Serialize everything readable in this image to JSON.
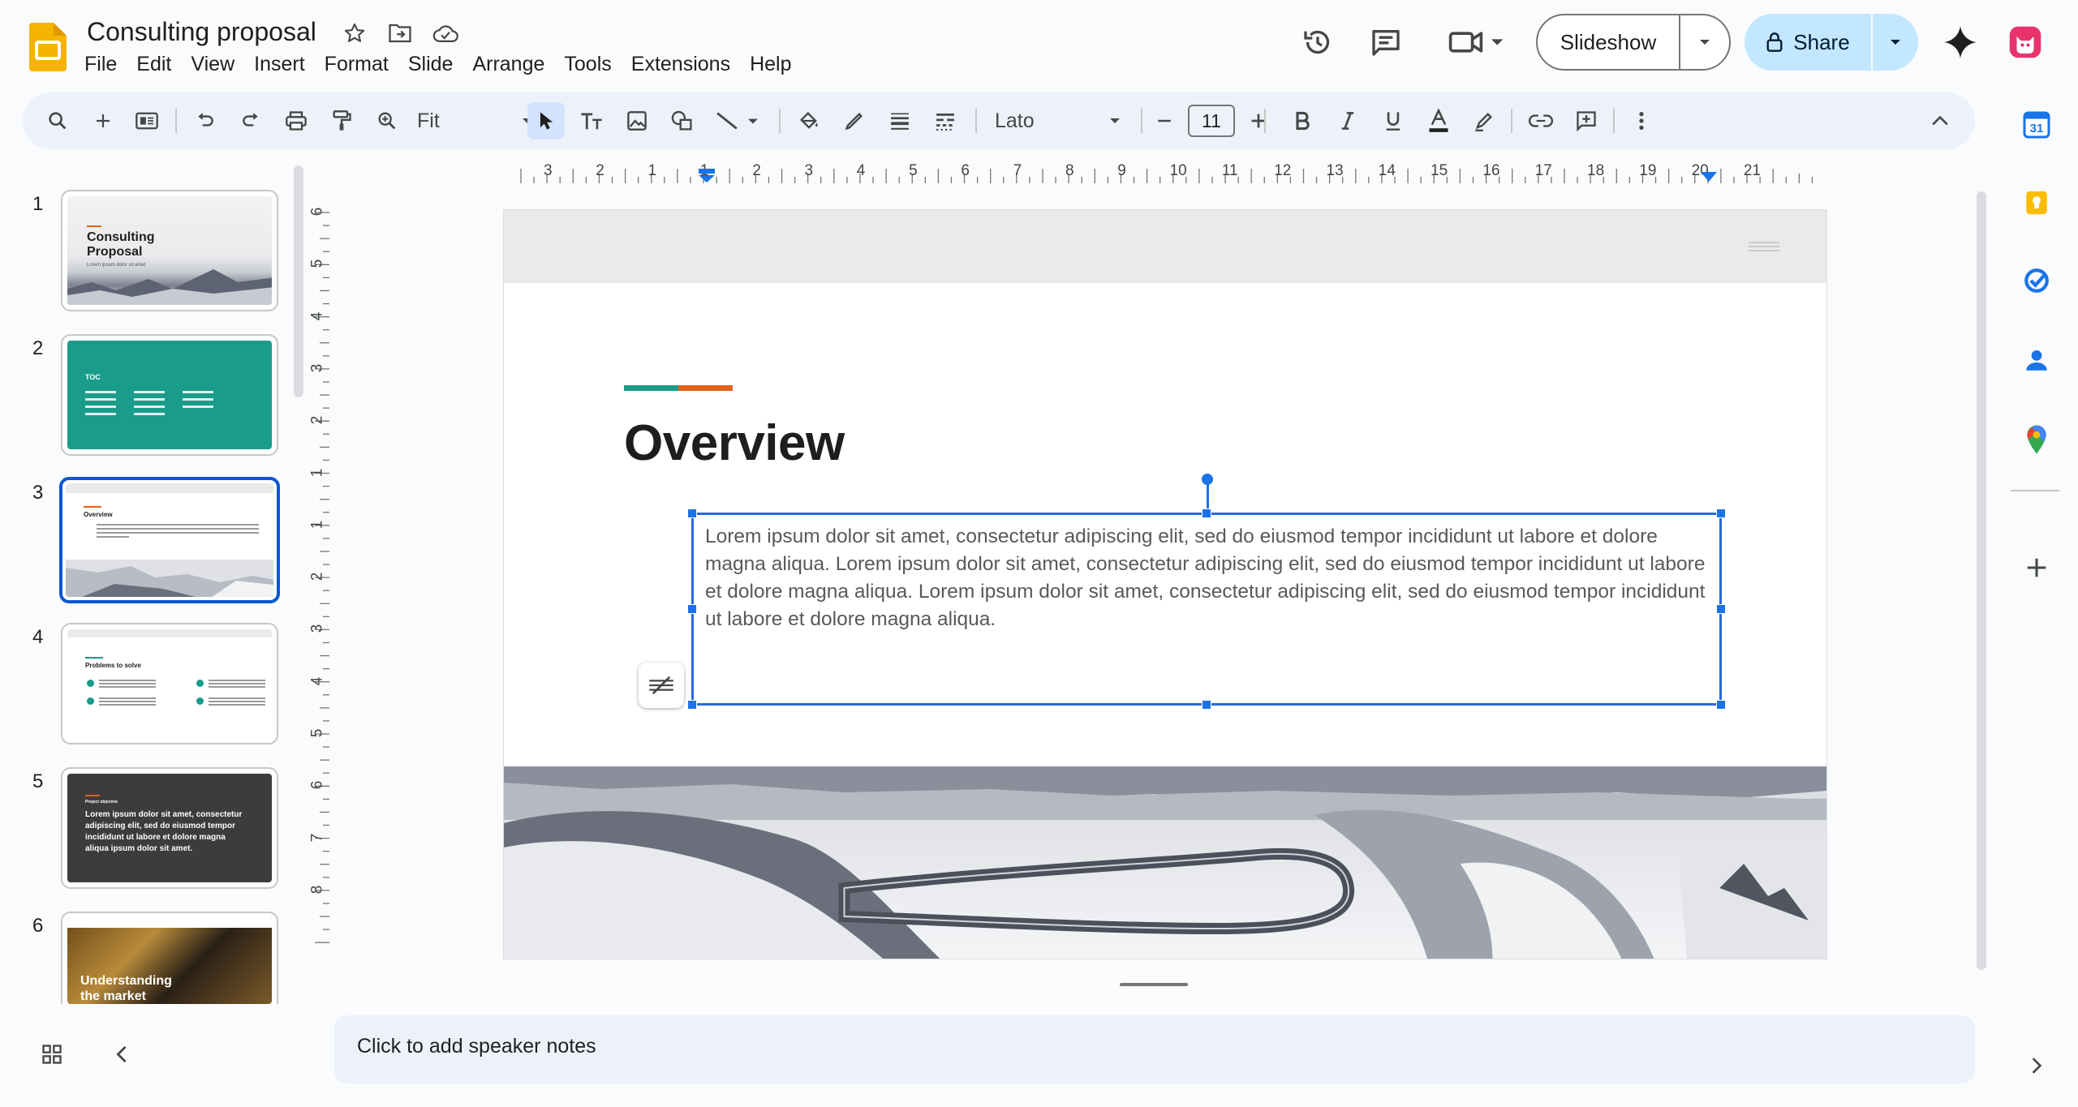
{
  "header": {
    "doc_title": "Consulting proposal",
    "menu": [
      "File",
      "Edit",
      "View",
      "Insert",
      "Format",
      "Slide",
      "Arrange",
      "Tools",
      "Extensions",
      "Help"
    ],
    "slideshow_label": "Slideshow",
    "share_label": "Share",
    "icons": [
      "star-icon",
      "move-to-folder-icon",
      "cloud-saved-icon",
      "version-history-icon",
      "comments-icon",
      "meet-icon",
      "gemini-icon",
      "profile-avatar"
    ]
  },
  "toolbar": {
    "zoom": "Fit",
    "font": "Lato",
    "font_size": "11"
  },
  "filmstrip": {
    "slides": [
      {
        "num": "1",
        "title": "Consulting Proposal",
        "sub": "Lorem ipsum dolor sit amet"
      },
      {
        "num": "2",
        "title": "TOC"
      },
      {
        "num": "3",
        "title": "Overview"
      },
      {
        "num": "4",
        "title": "Problems to solve"
      },
      {
        "num": "5",
        "title": "Project objective",
        "body": "Lorem ipsum dolor sit amet, consectetur adipiscing elit, sed do eiusmod tempor incididunt ut labore et dolore magna aliqua ipsum dolor sit amet."
      },
      {
        "num": "6",
        "title": "Understanding the market"
      }
    ]
  },
  "ruler": {
    "h_labels": [
      "3",
      "2",
      "1",
      "1",
      "2",
      "3",
      "4",
      "5",
      "6",
      "7",
      "8",
      "9",
      "10",
      "11",
      "12",
      "13",
      "14",
      "15",
      "16",
      "17",
      "18",
      "19",
      "20",
      "21"
    ],
    "v_labels": [
      "6",
      "5",
      "4",
      "3",
      "2",
      "1",
      "1",
      "2",
      "3",
      "4",
      "5",
      "6",
      "7",
      "8"
    ]
  },
  "slide": {
    "title": "Overview",
    "body": "Lorem ipsum dolor sit amet, consectetur adipiscing elit, sed do eiusmod tempor incididunt ut labore et dolore magna aliqua. Lorem ipsum dolor sit amet, consectetur adipiscing elit, sed do eiusmod tempor incididunt ut labore et dolore magna aliqua. Lorem ipsum dolor sit amet, consectetur adipiscing elit, sed do eiusmod tempor incididunt ut labore et dolore magna aliqua.",
    "accent_colors": [
      "#1a9c8a",
      "#e2621b"
    ]
  },
  "notes": {
    "placeholder": "Click to add speaker notes"
  },
  "colors": {
    "accent_blue": "#0b57d0",
    "share_bg": "#c2e7ff",
    "toc_green": "#1a9c8a",
    "dark_slide": "#3c3c3c"
  }
}
